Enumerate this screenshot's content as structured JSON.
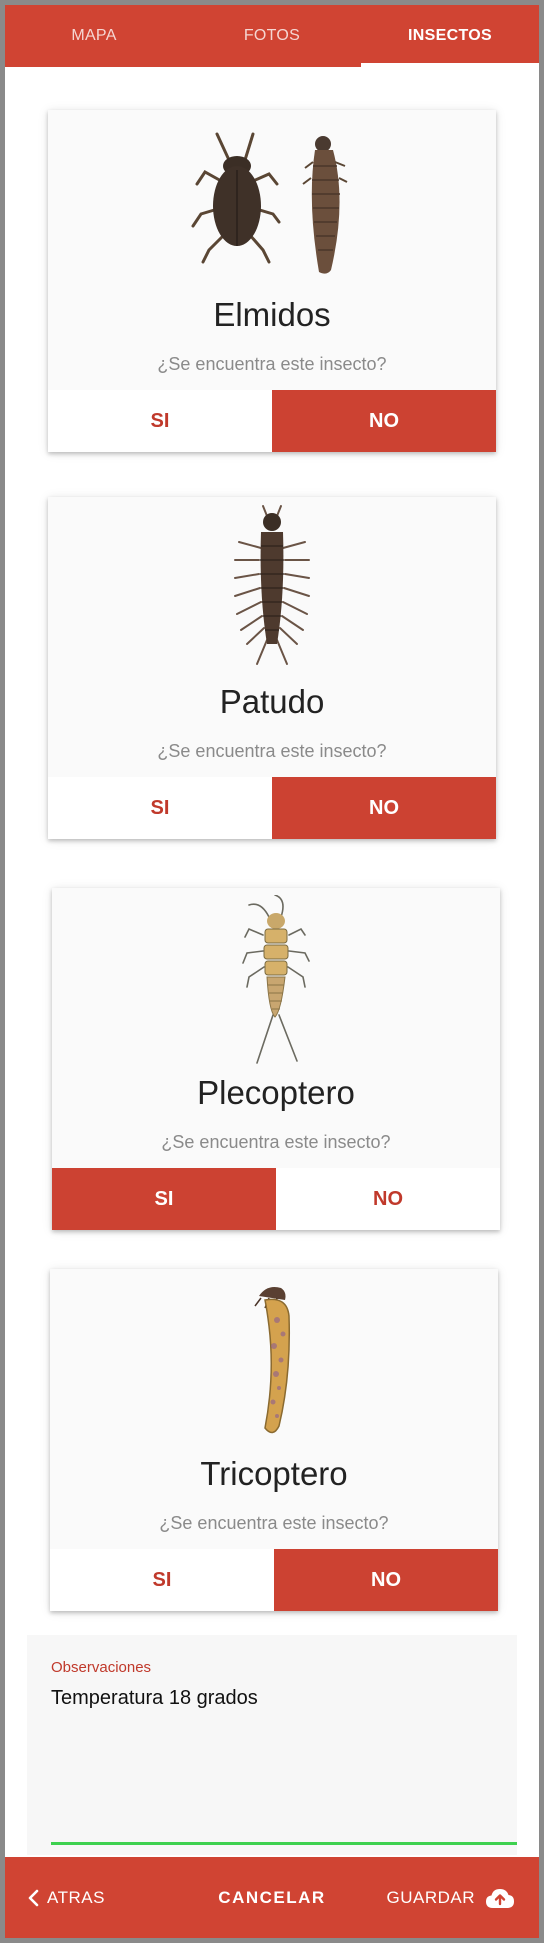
{
  "tabs": [
    {
      "label": "MAPA",
      "active": false
    },
    {
      "label": "FOTOS",
      "active": false
    },
    {
      "label": "INSECTOS",
      "active": true
    }
  ],
  "question": "¿Se encuentra este insecto?",
  "yes_label": "SI",
  "no_label": "NO",
  "insects": [
    {
      "name": "Elmidos",
      "answer": "NO",
      "icon": "elmidos-beetle-icon"
    },
    {
      "name": "Patudo",
      "answer": "NO",
      "icon": "patudo-larva-icon"
    },
    {
      "name": "Plecoptero",
      "answer": "SI",
      "icon": "plecoptero-stonefly-icon"
    },
    {
      "name": "Tricoptero",
      "answer": "NO",
      "icon": "tricoptero-caddisfly-icon"
    }
  ],
  "observations": {
    "label": "Observaciones",
    "value": "Temperatura 18 grados"
  },
  "bottom_bar": {
    "back_label": "ATRAS",
    "cancel_label": "CANCELAR",
    "save_label": "GUARDAR"
  },
  "colors": {
    "primary": "#d04433",
    "button_active": "#cc4232",
    "focus_line": "#3ed14f"
  }
}
